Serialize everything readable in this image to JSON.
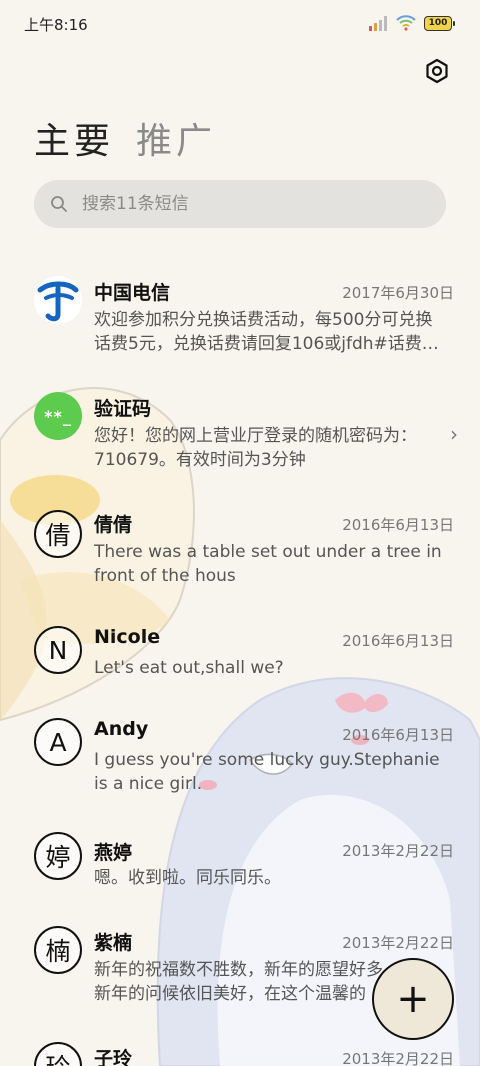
{
  "status_bar": {
    "time": "上午8:16",
    "battery": "100"
  },
  "tabs": [
    {
      "label": "主要",
      "active": true
    },
    {
      "label": "推广",
      "active": false
    }
  ],
  "search": {
    "placeholder": "搜索11条短信"
  },
  "messages": [
    {
      "name": "中国电信",
      "date": "2017年6月30日",
      "preview": [
        "欢迎参加积分兑换话费活动，每500分可兑换",
        "话费5元，兑换话费请回复106或jfdh#话费…"
      ],
      "avatar_type": "logo",
      "avatar_text": ""
    },
    {
      "name": "验证码",
      "date": "",
      "preview": [
        "您好！您的网上营业厅登录的随机密码为：",
        "710679。有效时间为3分钟"
      ],
      "avatar_type": "green",
      "avatar_text": "**_"
    },
    {
      "name": "倩倩",
      "date": "2016年6月13日",
      "preview": [
        "There was a table set out under a tree in",
        "front of the hous"
      ],
      "avatar_type": "outline",
      "avatar_text": "倩"
    },
    {
      "name": "Nicole",
      "date": "2016年6月13日",
      "preview": [
        "Let's eat out,shall we?"
      ],
      "avatar_type": "outline",
      "avatar_text": "N"
    },
    {
      "name": "Andy",
      "date": "2016年6月13日",
      "preview": [
        "I guess you're some lucky guy.Stephanie",
        "is a nice girl."
      ],
      "avatar_type": "outline",
      "avatar_text": "A"
    },
    {
      "name": "燕婷",
      "date": "2013年2月22日",
      "preview": [
        "嗯。收到啦。同乐同乐。"
      ],
      "avatar_type": "outline",
      "avatar_text": "婷"
    },
    {
      "name": "紫楠",
      "date": "2013年2月22日",
      "preview": [
        "新年的祝福数不胜数，新年的愿望好多",
        "新年的问候依旧美好，在这个温馨的"
      ],
      "avatar_type": "outline",
      "avatar_text": "楠"
    },
    {
      "name": "子玲",
      "date": "2013年2月22日",
      "preview": [],
      "avatar_type": "outline",
      "avatar_text": "玲"
    }
  ],
  "fab": {
    "icon": "plus-icon",
    "label": "+"
  }
}
